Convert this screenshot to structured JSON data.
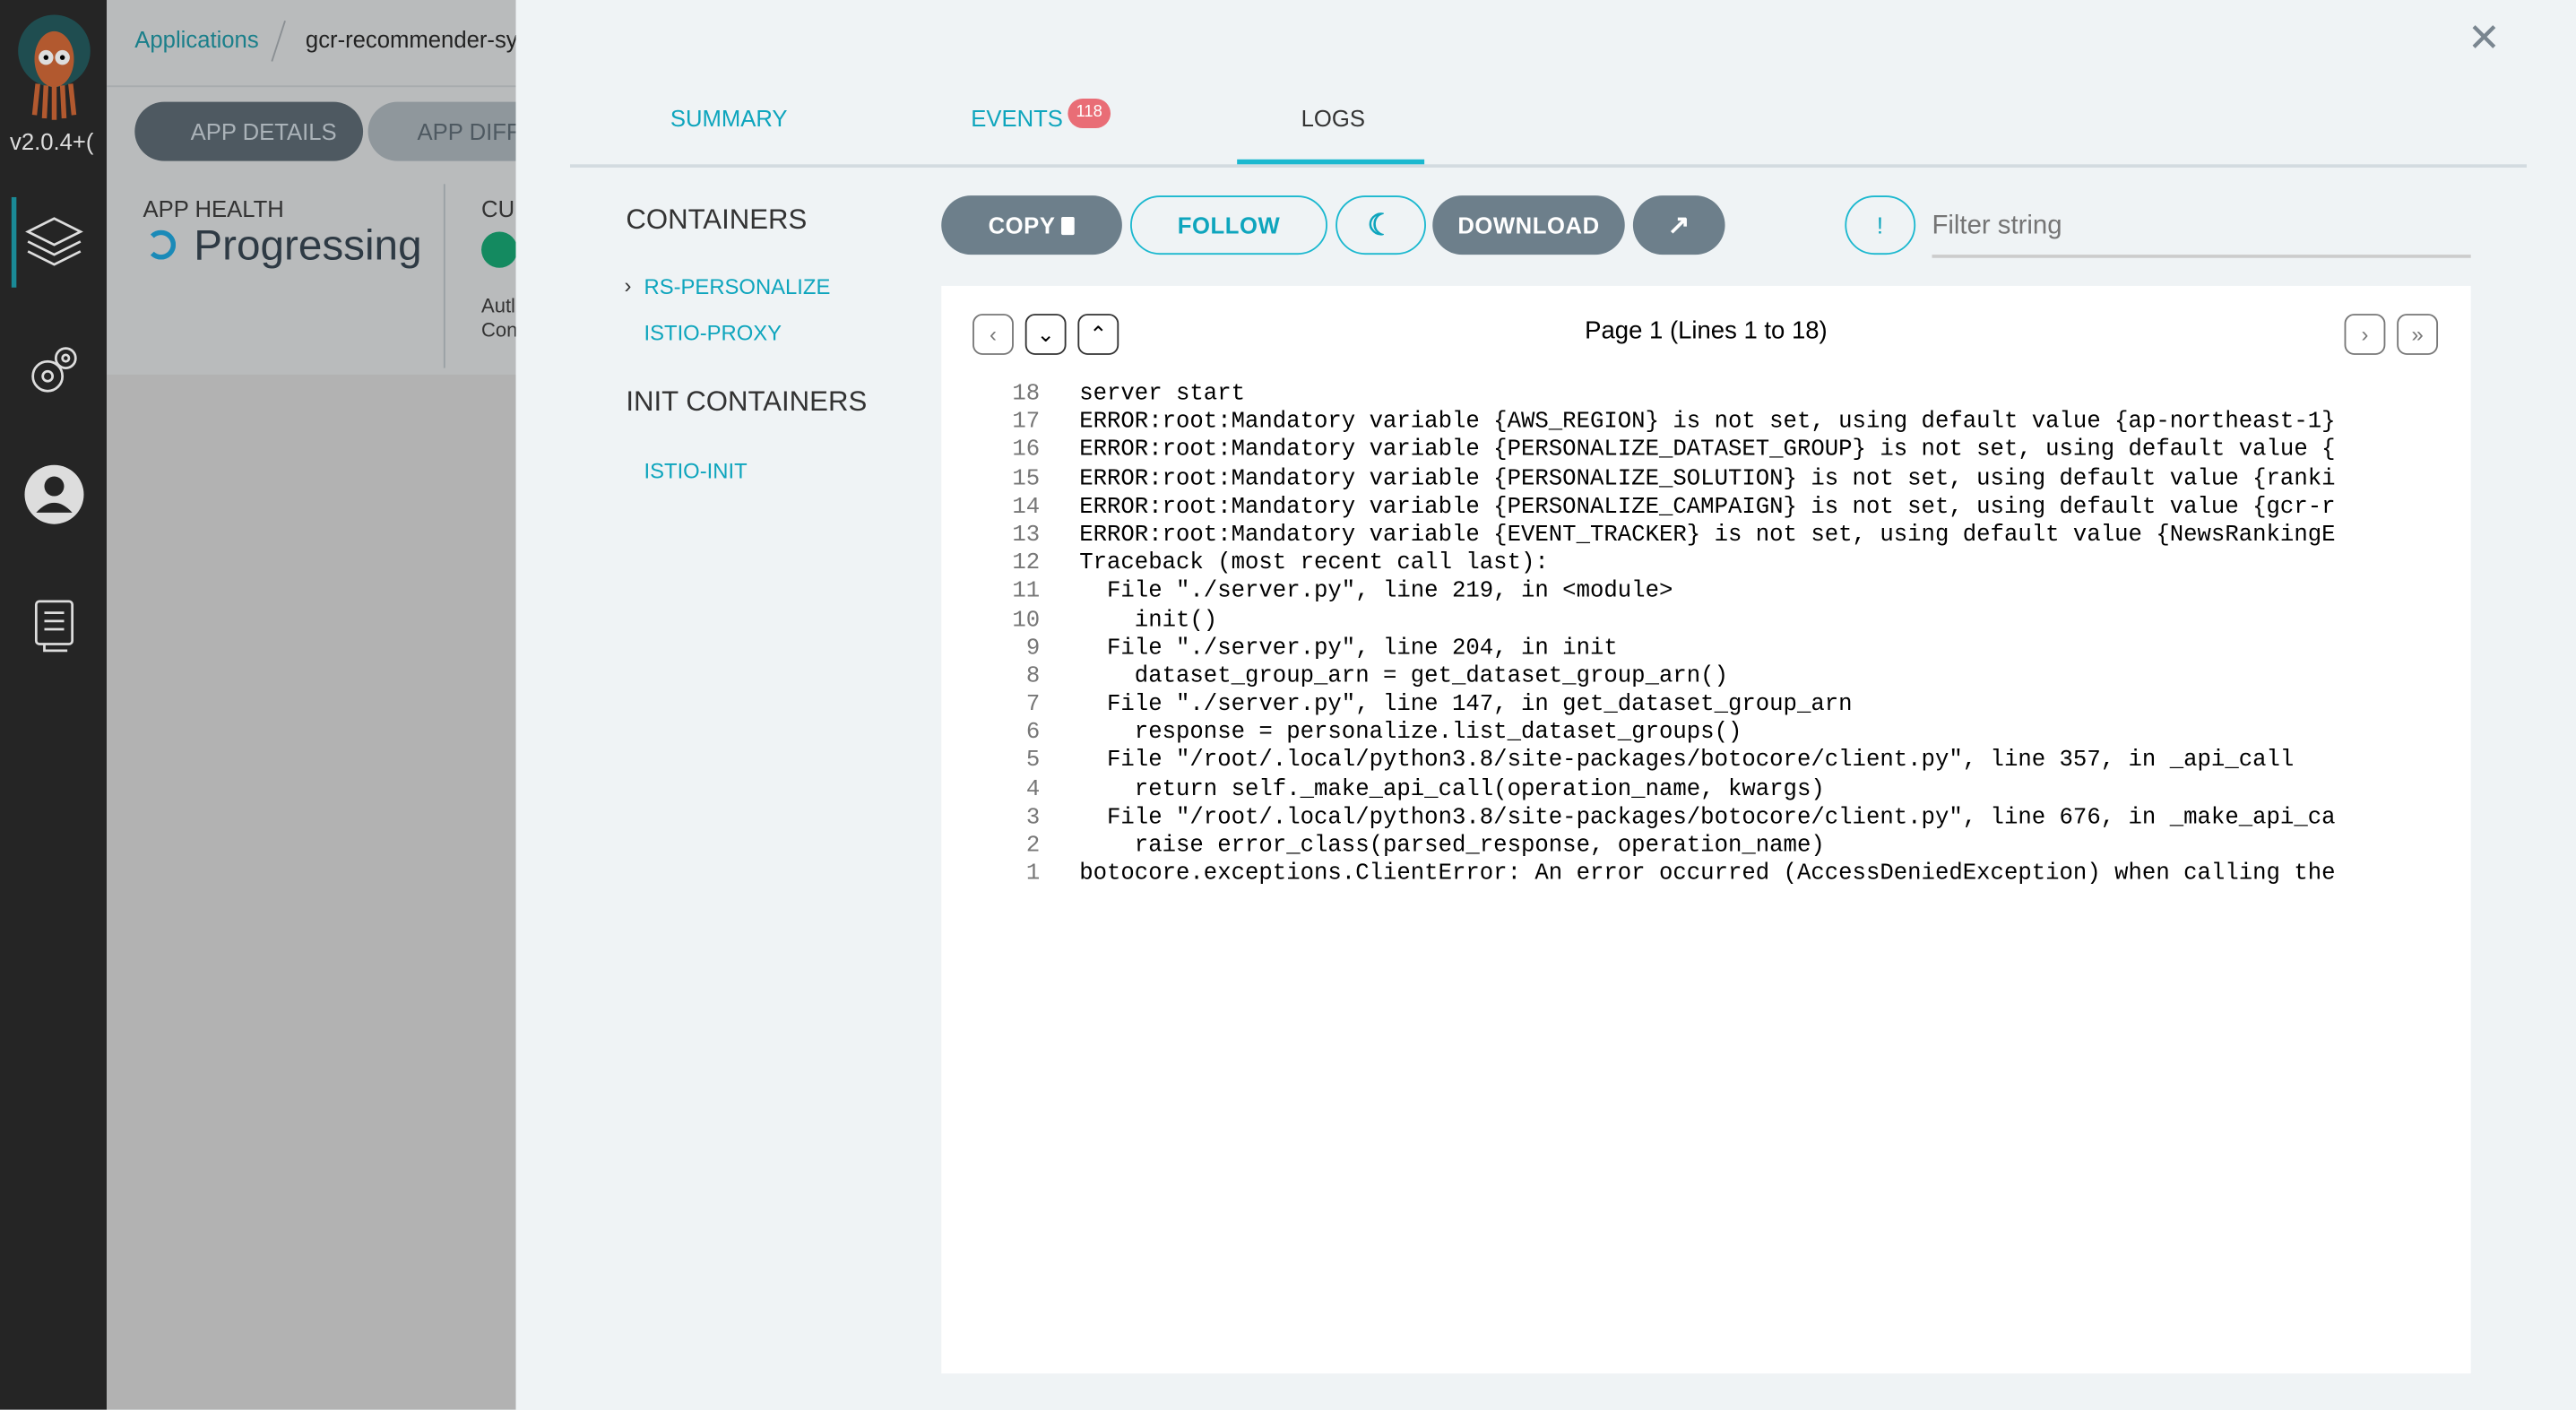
{
  "sidebar": {
    "version": "v2.0.4+(",
    "icons": [
      "argo-logo",
      "layers-icon",
      "gears-icon",
      "user-icon",
      "docs-icon"
    ]
  },
  "background": {
    "breadcrumb": {
      "root": "Applications",
      "current": "gcr-recommender-sy"
    },
    "buttons": {
      "app_details": "APP DETAILS",
      "app_diff": "APP DIFF"
    },
    "health": {
      "label": "APP HEALTH",
      "status": "Progressing"
    },
    "sync": {
      "label": "CUI",
      "line1": "Autl",
      "line2": "Con"
    }
  },
  "panel": {
    "tabs": [
      {
        "label": "SUMMARY"
      },
      {
        "label": "EVENTS",
        "badge": "118"
      },
      {
        "label": "LOGS",
        "active": true
      }
    ],
    "containers_title": "CONTAINERS",
    "containers": [
      {
        "label": "RS-PERSONALIZE",
        "selected": true
      },
      {
        "label": "ISTIO-PROXY"
      }
    ],
    "init_title": "INIT CONTAINERS",
    "init_containers": [
      {
        "label": "ISTIO-INIT"
      }
    ],
    "toolbar": {
      "copy": "COPY",
      "follow": "FOLLOW",
      "download": "DOWNLOAD",
      "filter_placeholder": "Filter string",
      "info": "!"
    },
    "pager": {
      "label": "Page 1 (Lines 1 to 18)"
    },
    "logs": [
      {
        "n": "18",
        "t": "server start"
      },
      {
        "n": "17",
        "t": "ERROR:root:Mandatory variable {AWS_REGION} is not set, using default value {ap-northeast-1}"
      },
      {
        "n": "16",
        "t": "ERROR:root:Mandatory variable {PERSONALIZE_DATASET_GROUP} is not set, using default value {"
      },
      {
        "n": "15",
        "t": "ERROR:root:Mandatory variable {PERSONALIZE_SOLUTION} is not set, using default value {ranki"
      },
      {
        "n": "14",
        "t": "ERROR:root:Mandatory variable {PERSONALIZE_CAMPAIGN} is not set, using default value {gcr-r"
      },
      {
        "n": "13",
        "t": "ERROR:root:Mandatory variable {EVENT_TRACKER} is not set, using default value {NewsRankingE"
      },
      {
        "n": "12",
        "t": "Traceback (most recent call last):"
      },
      {
        "n": "11",
        "t": "  File \"./server.py\", line 219, in <module>"
      },
      {
        "n": "10",
        "t": "    init()"
      },
      {
        "n": "9",
        "t": "  File \"./server.py\", line 204, in init"
      },
      {
        "n": "8",
        "t": "    dataset_group_arn = get_dataset_group_arn()"
      },
      {
        "n": "7",
        "t": "  File \"./server.py\", line 147, in get_dataset_group_arn"
      },
      {
        "n": "6",
        "t": "    response = personalize.list_dataset_groups()"
      },
      {
        "n": "5",
        "t": "  File \"/root/.local/python3.8/site-packages/botocore/client.py\", line 357, in _api_call"
      },
      {
        "n": "4",
        "t": "    return self._make_api_call(operation_name, kwargs)"
      },
      {
        "n": "3",
        "t": "  File \"/root/.local/python3.8/site-packages/botocore/client.py\", line 676, in _make_api_ca"
      },
      {
        "n": "2",
        "t": "    raise error_class(parsed_response, operation_name)"
      },
      {
        "n": "1",
        "t": "botocore.exceptions.ClientError: An error occurred (AccessDeniedException) when calling the"
      }
    ]
  },
  "colors": {
    "accent": "#1bb8cf",
    "badge": "#e96d76",
    "button_dark": "#6d7f8b"
  }
}
